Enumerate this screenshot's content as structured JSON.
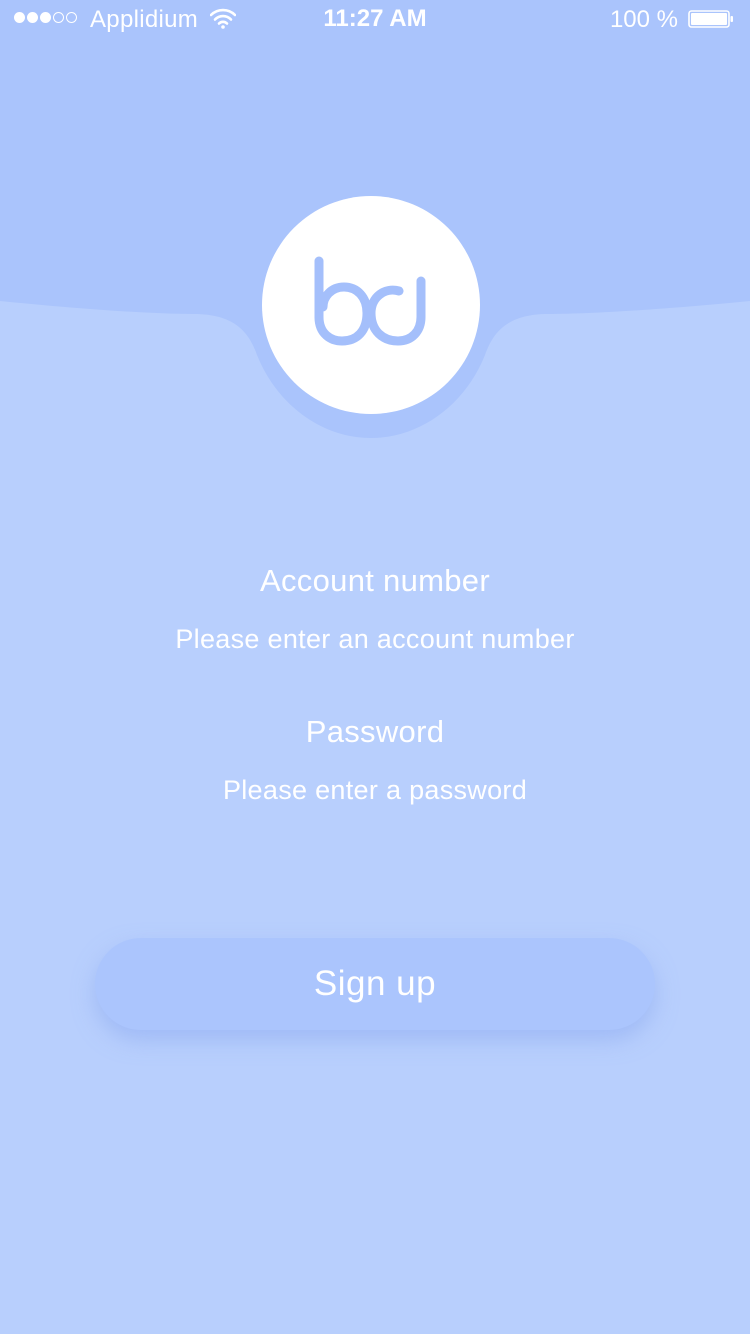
{
  "status_bar": {
    "carrier": "Applidium",
    "time": "11:27 AM",
    "battery_percent": "100 %",
    "signal_bars_filled": 3,
    "signal_bars_total": 5,
    "battery_level": 1.0
  },
  "logo": {
    "icon": "bq-logo-icon"
  },
  "form": {
    "account_label": "Account number",
    "account_placeholder": "Please enter an account number",
    "password_label": "Password",
    "password_placeholder": "Please enter a password"
  },
  "actions": {
    "signup_label": "Sign up"
  },
  "colors": {
    "background": "#b8cffd",
    "header": "#aac4fc",
    "logo_accent": "#a4bffb",
    "text": "#ffffff",
    "button": "#abc5fd"
  }
}
